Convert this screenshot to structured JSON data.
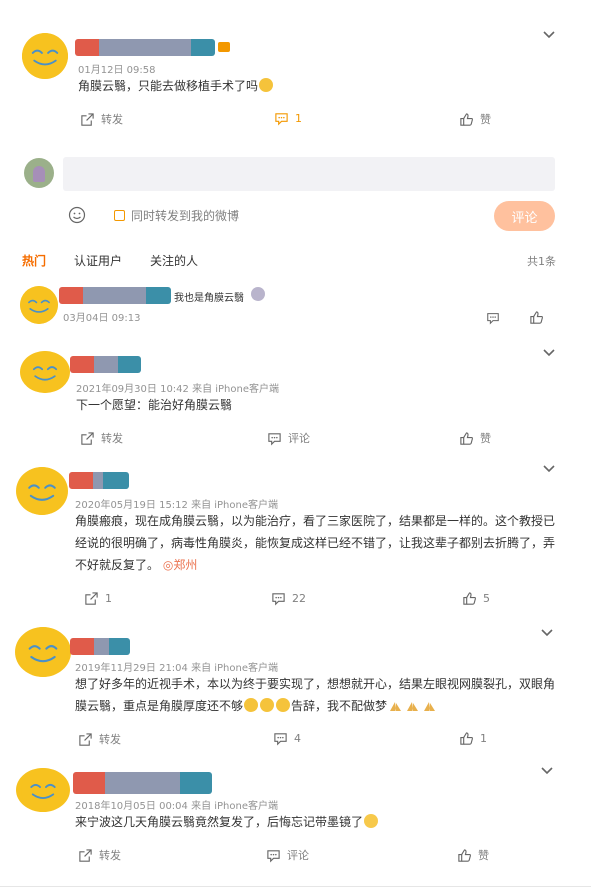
{
  "top_comment": {
    "date": "01月12日 09:58",
    "text": "角膜云翳，只能去做移植手术了吗",
    "actions": {
      "repost": "转发",
      "comment": "1",
      "like": "赞"
    }
  },
  "composer": {
    "placeholder": "",
    "repost_label": "同时转发到我的微博",
    "submit_label": "评论"
  },
  "tabs": {
    "hot": "热门",
    "verified": "认证用户",
    "following": "关注的人",
    "count": "共1条"
  },
  "reply": {
    "text_after_name": "我也是角膜云翳",
    "date": "03月04日 09:13"
  },
  "posts": [
    {
      "meta": "2021年09月30日 10:42  来自 iPhone客户端",
      "text": "下一个愿望：能治好角膜云翳",
      "repost": "转发",
      "comment": "评论",
      "like": "赞"
    },
    {
      "meta": "2020年05月19日 15:12  来自 iPhone客户端",
      "text": "角膜瘢痕，现在成角膜云翳，以为能治疗，看了三家医院了，结果都是一样的。这个教授已经说的很明确了，病毒性角膜炎，能恢复成这样已经不错了，让我这辈子都别去折腾了，弄不好就反复了。",
      "location": "郑州",
      "repost": "1",
      "comment": "22",
      "like": "5"
    },
    {
      "meta": "2019年11月29日 21:04  来自 iPhone客户端",
      "text_a": "想了好多年的近视手术，本以为终于要实现了，想想就开心，结果左眼视网膜裂孔，双眼角膜云翳，重点是角膜厚度还不够",
      "text_b": "告辞，我不配做梦",
      "repost": "转发",
      "comment": "4",
      "like": "1"
    },
    {
      "meta": "2018年10月05日 00:04  来自 iPhone客户端",
      "text": "来宁波这几天角膜云翳竟然复发了，后悔忘记带墨镜了",
      "repost": "转发",
      "comment": "评论",
      "like": "赞"
    }
  ],
  "colors": {
    "accent": "#f56d00",
    "name_red": "#e05b4a",
    "name_gray": "#8f98b0",
    "name_teal": "#3b8fa8",
    "avatar": "#f7c21f"
  }
}
